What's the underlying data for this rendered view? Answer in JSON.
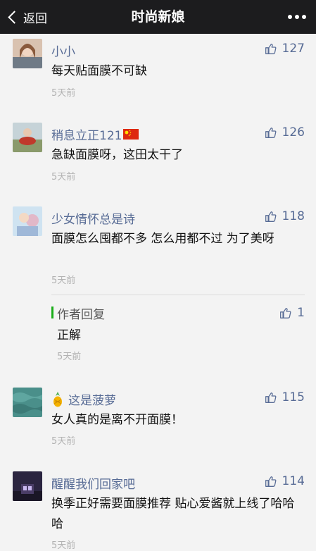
{
  "header": {
    "back_label": "返回",
    "title": "时尚新娘"
  },
  "comments": [
    {
      "name": "小小",
      "text": "每天贴面膜不可缺",
      "time": "5天前",
      "likes": "127"
    },
    {
      "name": "稍息立正121",
      "text": "急缺面膜呀，这田太干了",
      "time": "5天前",
      "likes": "126"
    },
    {
      "name": "少女情怀总是诗",
      "text": "面膜怎么囤都不多 怎么用都不过 为了美呀",
      "time": "5天前",
      "likes": "118"
    },
    {
      "name": "这是菠萝",
      "text": "女人真的是离不开面膜！",
      "time": "5天前",
      "likes": "115"
    },
    {
      "name": "醒醒我们回家吧",
      "text": "换季正好需要面膜推荐 贴心爱酱就上线了哈哈哈",
      "time": "5天前",
      "likes": "114"
    }
  ],
  "author_reply": {
    "label": "作者回复",
    "text": "正解",
    "time": "5天前",
    "likes": "1"
  },
  "colors": {
    "nickname": "#576b95",
    "reply_accent": "#1aad19",
    "topbar": "#1c1c1e"
  },
  "icons": {
    "back": "chevron-left-icon",
    "more": "more-dots-icon",
    "like": "thumbs-up-icon",
    "flag": "china-flag-icon",
    "emoji": "pineapple-emoji-icon"
  }
}
